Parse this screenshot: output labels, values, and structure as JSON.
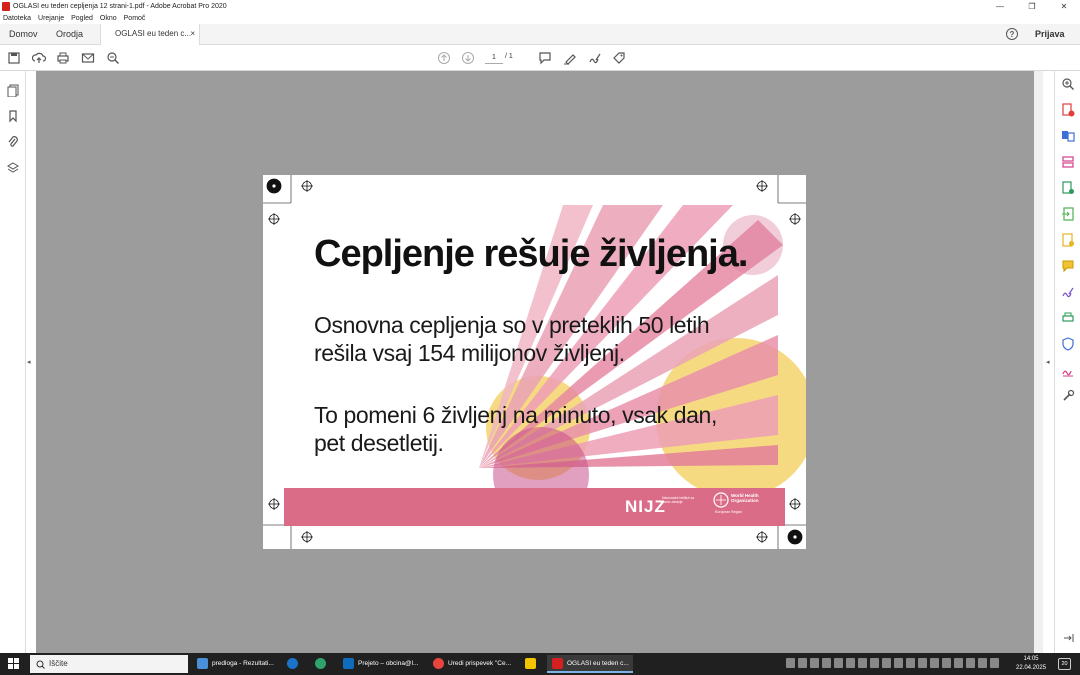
{
  "window": {
    "title": "OGLASI eu teden cepljenja 12 strani-1.pdf - Adobe Acrobat Pro 2020",
    "minimize": "—",
    "restore": "❐",
    "close": "✕"
  },
  "menu": [
    "Datoteka",
    "Urejanje",
    "Pogled",
    "Okno",
    "Pomoč"
  ],
  "tabs": {
    "home": "Domov",
    "tools": "Orodja",
    "doc": "OGLASI eu teden c...",
    "close": "×",
    "help": "?",
    "signin": "Prijava"
  },
  "toolbar": {
    "page_current": "1",
    "page_total": "/ 1"
  },
  "document": {
    "headline": "Cepljenje rešuje življenja.",
    "paragraph1": "Osnovna cepljenja so v preteklih 50 letih rešila vsaj 154 milijonov življenj.",
    "paragraph2": "To pomeni 6 življenj na minuto, vsak dan, pet desetletij.",
    "nijz_logo": "NIJZ",
    "nijz_sub": "Nacionalni inštitut za javno zdravje",
    "who_name": "World Health Organization",
    "who_region": "European Region"
  },
  "taskbar": {
    "search_placeholder": "Iščite",
    "items": [
      "predloga - Rezultati...",
      "Prejeto – obcina@l...",
      "Uredi prispevek \"Ce...",
      "OGLASI eu teden c..."
    ],
    "time": "14:05",
    "date": "22.04.2025",
    "notifications": "20"
  },
  "colors": {
    "doc_bg": "#9c9c9c",
    "accent_pink": "#db6c87",
    "taskbar": "#202020"
  }
}
